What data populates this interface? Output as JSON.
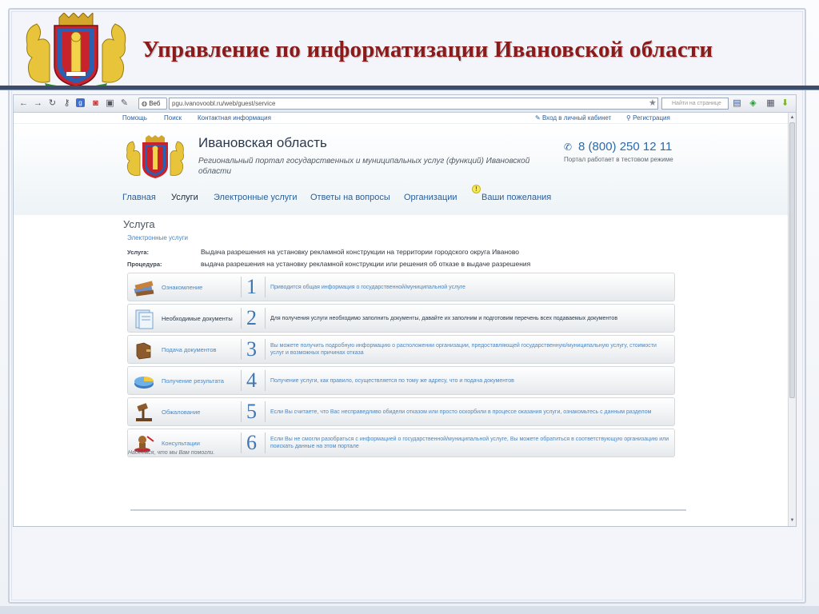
{
  "slide": {
    "title": "Управление по информатизации Ивановской области"
  },
  "browser": {
    "tab_label": "Веб",
    "url": "pgu.ivanovoobl.ru/web/guest/service",
    "search_placeholder": "Найти на странице"
  },
  "topbar": {
    "help": "Помощь",
    "search": "Поиск",
    "contact": "Контактная информация",
    "login": "Вход в личный кабинет",
    "register": "Регистрация"
  },
  "header": {
    "region_title": "Ивановская область",
    "subtitle": "Региональный портал государственных и муниципальных услуг (функций) Ивановской области",
    "phone": "8 (800) 250 12 11",
    "phone_note": "Портал работает в тестовом режиме"
  },
  "nav": {
    "items": [
      {
        "label": "Главная"
      },
      {
        "label": "Услуги"
      },
      {
        "label": "Электронные услуги"
      },
      {
        "label": "Ответы на вопросы"
      },
      {
        "label": "Организации"
      },
      {
        "label": "Ваши пожелания"
      }
    ],
    "alert_badge": "!"
  },
  "content": {
    "section_title": "Услуга",
    "breadcrumb": "Электронные услуги",
    "service_label": "Услуга:",
    "service_value": "Выдача разрешения на установку рекламной конструкции на территории городского округа Иваново",
    "procedure_label": "Процедура:",
    "procedure_value": "выдача разрешения на установку рекламной конструкции или решения об отказе в выдаче разрешения",
    "steps": [
      {
        "num": "1",
        "name": "Ознакомление",
        "desc": "Приводится общая информация о государственной/муниципальной услуге",
        "icon": "books-icon"
      },
      {
        "num": "2",
        "name": "Необходимые документы",
        "desc": "Для получения услуги необходимо заполнить документы, давайте их заполним и подготовим перечень всех подаваемых документов",
        "icon": "documents-icon"
      },
      {
        "num": "3",
        "name": "Подача документов",
        "desc": "Вы можете получить подробную информацию о расположении организации, предоставляющей государственную/муниципальную услугу, стоимости услуг и возможных причинах отказа",
        "icon": "folder-icon"
      },
      {
        "num": "4",
        "name": "Получение результата",
        "desc": "Получение услуги, как правило, осуществляется по тому же адресу, что и подача документов",
        "icon": "disc-icon"
      },
      {
        "num": "5",
        "name": "Обжалование",
        "desc": "Если Вы считаете, что Вас несправедливо обидели отказом или просто оскорбили в процессе оказания услуги, ознакомьтесь с данным разделом",
        "icon": "gavel-icon"
      },
      {
        "num": "6",
        "name": "Консультации",
        "desc": "Если Вы не смогли разобраться с информацией о государственной/муниципальной услуге, Вы можете обратиться в соответствующую организацию или поискать данные на этом портале",
        "icon": "stamp-icon"
      }
    ],
    "thanks": "Надеемся, что мы Вам помогли."
  }
}
